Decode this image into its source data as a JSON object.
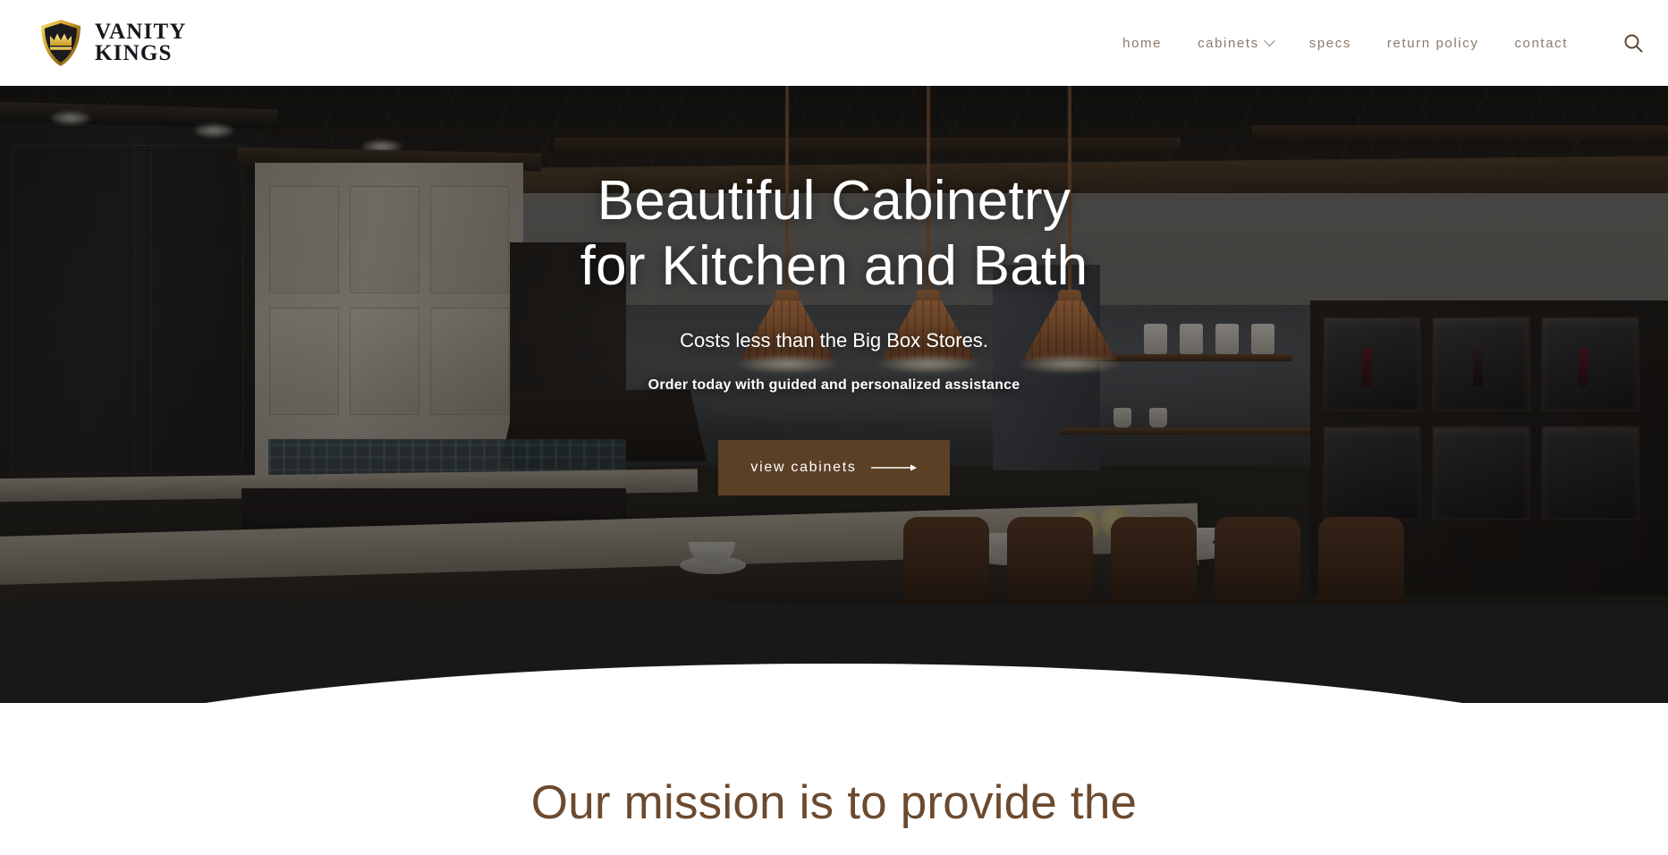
{
  "brand": {
    "logo_line1": "VANITY",
    "logo_line2": "KINGS",
    "logo_icon": "shield-crown-icon",
    "gold": "#e8c547",
    "shield_dark": "#1b1b1f"
  },
  "nav": {
    "items": [
      {
        "label": "home",
        "has_dropdown": false,
        "icon": ""
      },
      {
        "label": "cabinets",
        "has_dropdown": true,
        "icon": "chevron-down-icon"
      },
      {
        "label": "specs",
        "has_dropdown": false,
        "icon": ""
      },
      {
        "label": "return policy",
        "has_dropdown": false,
        "icon": ""
      },
      {
        "label": "contact",
        "has_dropdown": false,
        "icon": ""
      }
    ],
    "search_icon": "search-icon",
    "text_color": "#8b7a6d"
  },
  "hero": {
    "title_line1": "Beautiful Cabinetry",
    "title_line2": "for Kitchen and Bath",
    "subtitle": "Costs less than the Big Box Stores.",
    "subtitle2": "Order today with guided and personalized assistance",
    "cta_label": "view cabinets",
    "cta_icon": "arrow-right-icon",
    "cta_color": "#5c4025",
    "overlay_color": "#0a0908"
  },
  "band": {
    "color": "#181818"
  },
  "mission": {
    "title": "Our mission is to provide the",
    "color": "#6b4a2f"
  }
}
